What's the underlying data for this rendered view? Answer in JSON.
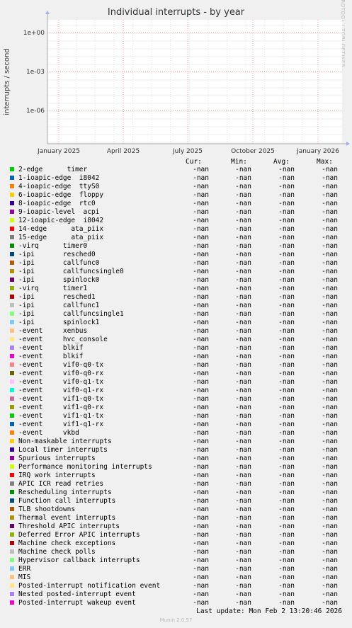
{
  "chart_data": {
    "type": "line",
    "title": "Individual interrupts - by year",
    "ylabel": "interrupts / second",
    "yscale": "log",
    "y_ticks": [
      "1e+00",
      "1e-03",
      "1e-06"
    ],
    "x_ticks": [
      "January 2025",
      "April 2025",
      "July 2025",
      "October 2025",
      "January 2026"
    ],
    "series_values": "-nan",
    "grid": true
  },
  "watermark": "RRDTOOL / TOBI OETIKER",
  "headers": {
    "cur": "Cur:",
    "min": "Min:",
    "avg": "Avg:",
    "max": "Max:"
  },
  "legend": [
    {
      "label": "2-edge      timer",
      "color": "#00cc00",
      "cur": "-nan",
      "min": "-nan",
      "avg": "-nan",
      "max": "-nan"
    },
    {
      "label": "1-ioapic-edge  i8042",
      "color": "#0066b3",
      "cur": "-nan",
      "min": "-nan",
      "avg": "-nan",
      "max": "-nan"
    },
    {
      "label": "4-ioapic-edge  ttyS0",
      "color": "#ff8000",
      "cur": "-nan",
      "min": "-nan",
      "avg": "-nan",
      "max": "-nan"
    },
    {
      "label": "6-ioapic-edge  floppy",
      "color": "#ffcc00",
      "cur": "-nan",
      "min": "-nan",
      "avg": "-nan",
      "max": "-nan"
    },
    {
      "label": "8-ioapic-edge  rtc0",
      "color": "#330099",
      "cur": "-nan",
      "min": "-nan",
      "avg": "-nan",
      "max": "-nan"
    },
    {
      "label": "9-ioapic-level  acpi",
      "color": "#990099",
      "cur": "-nan",
      "min": "-nan",
      "avg": "-nan",
      "max": "-nan"
    },
    {
      "label": "12-ioapic-edge  i8042",
      "color": "#ccff00",
      "cur": "-nan",
      "min": "-nan",
      "avg": "-nan",
      "max": "-nan"
    },
    {
      "label": "14-edge      ata_piix",
      "color": "#ff0000",
      "cur": "-nan",
      "min": "-nan",
      "avg": "-nan",
      "max": "-nan"
    },
    {
      "label": "15-edge      ata_piix",
      "color": "#808080",
      "cur": "-nan",
      "min": "-nan",
      "avg": "-nan",
      "max": "-nan"
    },
    {
      "label": "-virq      timer0",
      "color": "#008f00",
      "cur": "-nan",
      "min": "-nan",
      "avg": "-nan",
      "max": "-nan"
    },
    {
      "label": "-ipi       resched0",
      "color": "#00487d",
      "cur": "-nan",
      "min": "-nan",
      "avg": "-nan",
      "max": "-nan"
    },
    {
      "label": "-ipi       callfunc0",
      "color": "#b35a00",
      "cur": "-nan",
      "min": "-nan",
      "avg": "-nan",
      "max": "-nan"
    },
    {
      "label": "-ipi       callfuncsingle0",
      "color": "#b38f00",
      "cur": "-nan",
      "min": "-nan",
      "avg": "-nan",
      "max": "-nan"
    },
    {
      "label": "-ipi       spinlock0",
      "color": "#6b006b",
      "cur": "-nan",
      "min": "-nan",
      "avg": "-nan",
      "max": "-nan"
    },
    {
      "label": "-virq      timer1",
      "color": "#8fb300",
      "cur": "-nan",
      "min": "-nan",
      "avg": "-nan",
      "max": "-nan"
    },
    {
      "label": "-ipi       resched1",
      "color": "#b30000",
      "cur": "-nan",
      "min": "-nan",
      "avg": "-nan",
      "max": "-nan"
    },
    {
      "label": "-ipi       callfunc1",
      "color": "#bebebe",
      "cur": "-nan",
      "min": "-nan",
      "avg": "-nan",
      "max": "-nan"
    },
    {
      "label": "-ipi       callfuncsingle1",
      "color": "#80ff80",
      "cur": "-nan",
      "min": "-nan",
      "avg": "-nan",
      "max": "-nan"
    },
    {
      "label": "-ipi       spinlock1",
      "color": "#80c9ff",
      "cur": "-nan",
      "min": "-nan",
      "avg": "-nan",
      "max": "-nan"
    },
    {
      "label": "-event     xenbus",
      "color": "#ffc080",
      "cur": "-nan",
      "min": "-nan",
      "avg": "-nan",
      "max": "-nan"
    },
    {
      "label": "-event     hvc_console",
      "color": "#ffe680",
      "cur": "-nan",
      "min": "-nan",
      "avg": "-nan",
      "max": "-nan"
    },
    {
      "label": "-event     blkif",
      "color": "#aa80ff",
      "cur": "-nan",
      "min": "-nan",
      "avg": "-nan",
      "max": "-nan"
    },
    {
      "label": "-event     blkif",
      "color": "#ee00cc",
      "cur": "-nan",
      "min": "-nan",
      "avg": "-nan",
      "max": "-nan"
    },
    {
      "label": "-event     vif0-q0-tx",
      "color": "#ff8080",
      "cur": "-nan",
      "min": "-nan",
      "avg": "-nan",
      "max": "-nan"
    },
    {
      "label": "-event     vif0-q0-rx",
      "color": "#666600",
      "cur": "-nan",
      "min": "-nan",
      "avg": "-nan",
      "max": "-nan"
    },
    {
      "label": "-event     vif0-q1-tx",
      "color": "#ffbfff",
      "cur": "-nan",
      "min": "-nan",
      "avg": "-nan",
      "max": "-nan"
    },
    {
      "label": "-event     vif0-q1-rx",
      "color": "#00ffcc",
      "cur": "-nan",
      "min": "-nan",
      "avg": "-nan",
      "max": "-nan"
    },
    {
      "label": "-event     vif1-q0-tx",
      "color": "#cc6699",
      "cur": "-nan",
      "min": "-nan",
      "avg": "-nan",
      "max": "-nan"
    },
    {
      "label": "-event     vif1-q0-rx",
      "color": "#999900",
      "cur": "-nan",
      "min": "-nan",
      "avg": "-nan",
      "max": "-nan"
    },
    {
      "label": "-event     vif1-q1-tx",
      "color": "#00cc00",
      "cur": "-nan",
      "min": "-nan",
      "avg": "-nan",
      "max": "-nan"
    },
    {
      "label": "-event     vif1-q1-rx",
      "color": "#0066b3",
      "cur": "-nan",
      "min": "-nan",
      "avg": "-nan",
      "max": "-nan"
    },
    {
      "label": "-event     vkbd",
      "color": "#ff8000",
      "cur": "-nan",
      "min": "-nan",
      "avg": "-nan",
      "max": "-nan"
    },
    {
      "label": "Non-maskable interrupts",
      "color": "#ffcc00",
      "cur": "-nan",
      "min": "-nan",
      "avg": "-nan",
      "max": "-nan"
    },
    {
      "label": "Local timer interrupts",
      "color": "#330099",
      "cur": "-nan",
      "min": "-nan",
      "avg": "-nan",
      "max": "-nan"
    },
    {
      "label": "Spurious interrupts",
      "color": "#990099",
      "cur": "-nan",
      "min": "-nan",
      "avg": "-nan",
      "max": "-nan"
    },
    {
      "label": "Performance monitoring interrupts",
      "color": "#ccff00",
      "cur": "-nan",
      "min": "-nan",
      "avg": "-nan",
      "max": "-nan"
    },
    {
      "label": "IRQ work interrupts",
      "color": "#ff0000",
      "cur": "-nan",
      "min": "-nan",
      "avg": "-nan",
      "max": "-nan"
    },
    {
      "label": "APIC ICR read retries",
      "color": "#808080",
      "cur": "-nan",
      "min": "-nan",
      "avg": "-nan",
      "max": "-nan"
    },
    {
      "label": "Rescheduling interrupts",
      "color": "#008f00",
      "cur": "-nan",
      "min": "-nan",
      "avg": "-nan",
      "max": "-nan"
    },
    {
      "label": "Function call interrupts",
      "color": "#00487d",
      "cur": "-nan",
      "min": "-nan",
      "avg": "-nan",
      "max": "-nan"
    },
    {
      "label": "TLB shootdowns",
      "color": "#b35a00",
      "cur": "-nan",
      "min": "-nan",
      "avg": "-nan",
      "max": "-nan"
    },
    {
      "label": "Thermal event interrupts",
      "color": "#b38f00",
      "cur": "-nan",
      "min": "-nan",
      "avg": "-nan",
      "max": "-nan"
    },
    {
      "label": "Threshold APIC interrupts",
      "color": "#6b006b",
      "cur": "-nan",
      "min": "-nan",
      "avg": "-nan",
      "max": "-nan"
    },
    {
      "label": "Deferred Error APIC interrupts",
      "color": "#8fb300",
      "cur": "-nan",
      "min": "-nan",
      "avg": "-nan",
      "max": "-nan"
    },
    {
      "label": "Machine check exceptions",
      "color": "#b30000",
      "cur": "-nan",
      "min": "-nan",
      "avg": "-nan",
      "max": "-nan"
    },
    {
      "label": "Machine check polls",
      "color": "#bebebe",
      "cur": "-nan",
      "min": "-nan",
      "avg": "-nan",
      "max": "-nan"
    },
    {
      "label": "Hypervisor callback interrupts",
      "color": "#80ff80",
      "cur": "-nan",
      "min": "-nan",
      "avg": "-nan",
      "max": "-nan"
    },
    {
      "label": "ERR",
      "color": "#80c9ff",
      "cur": "-nan",
      "min": "-nan",
      "avg": "-nan",
      "max": "-nan"
    },
    {
      "label": "MIS",
      "color": "#ffc080",
      "cur": "-nan",
      "min": "-nan",
      "avg": "-nan",
      "max": "-nan"
    },
    {
      "label": "Posted-interrupt notification event",
      "color": "#ffe680",
      "cur": "-nan",
      "min": "-nan",
      "avg": "-nan",
      "max": "-nan"
    },
    {
      "label": "Nested posted-interrupt event",
      "color": "#aa80ff",
      "cur": "-nan",
      "min": "-nan",
      "avg": "-nan",
      "max": "-nan"
    },
    {
      "label": "Posted-interrupt wakeup event",
      "color": "#ee00cc",
      "cur": "-nan",
      "min": "-nan",
      "avg": "-nan",
      "max": "-nan"
    }
  ],
  "last_update": "Last update: Mon Feb  2 13:20:46 2026",
  "version": "Munin 2.0.57"
}
